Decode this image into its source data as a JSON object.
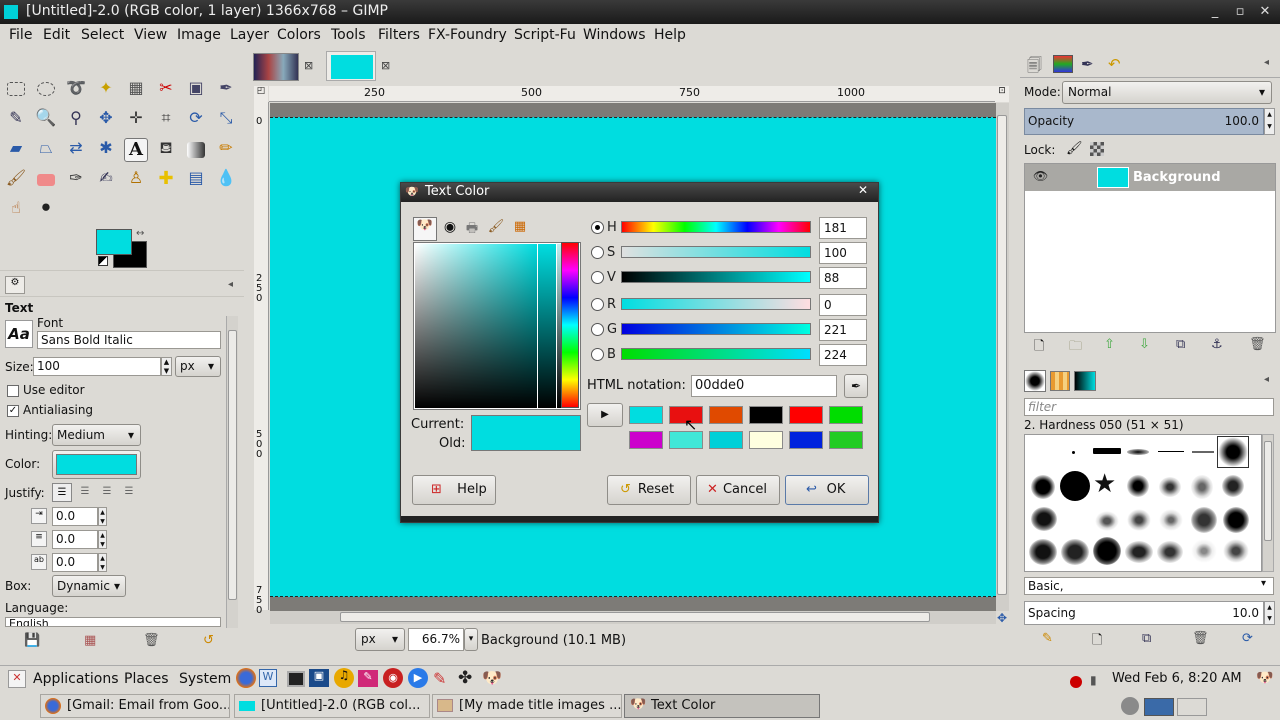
{
  "window": {
    "title": "[Untitled]-2.0 (RGB color, 1 layer) 1366x768 – GIMP"
  },
  "menu": [
    "File",
    "Edit",
    "Select",
    "View",
    "Image",
    "Layer",
    "Colors",
    "Tools",
    "Filters",
    "FX-Foundry",
    "Script-Fu",
    "Windows",
    "Help"
  ],
  "tool_options": {
    "title": "Text",
    "font_label": "Font",
    "font_value": "Sans Bold Italic",
    "size_label": "Size:",
    "size_value": "100",
    "size_unit": "px",
    "use_editor": "Use editor",
    "antialiasing": "Antialiasing",
    "hinting_label": "Hinting:",
    "hinting_value": "Medium",
    "color_label": "Color:",
    "justify_label": "Justify:",
    "indent": "0.0",
    "line_spacing": "0.0",
    "letter_spacing": "0.0",
    "box_label": "Box:",
    "box_value": "Dynamic",
    "language_label": "Language:",
    "language_value": "English"
  },
  "ruler": {
    "marks": [
      "250",
      "500",
      "750",
      "1000"
    ],
    "vmarks": [
      "0",
      "250",
      "500",
      "750"
    ]
  },
  "statusbar": {
    "unit": "px",
    "zoom": "66.7%",
    "layer_info": "Background (10.1 MB)"
  },
  "dialog": {
    "title": "Text Color",
    "channels": [
      {
        "key": "H",
        "value": "181"
      },
      {
        "key": "S",
        "value": "100"
      },
      {
        "key": "V",
        "value": "88"
      },
      {
        "key": "R",
        "value": "0"
      },
      {
        "key": "G",
        "value": "221"
      },
      {
        "key": "B",
        "value": "224"
      }
    ],
    "html_notation_label": "HTML notation:",
    "html_notation_value": "00dde0",
    "current_label": "Current:",
    "old_label": "Old:",
    "help": "Help",
    "reset": "Reset",
    "cancel": "Cancel",
    "ok": "OK",
    "history": [
      "#00dde0",
      "#e81010",
      "#e04a00",
      "#000000",
      "#ff0000",
      "#00dd00",
      "#cc00cc",
      "#40e8d8",
      "#00d0d8",
      "#ffffe0",
      "#0022dd",
      "#22cc22"
    ]
  },
  "layers": {
    "mode_label": "Mode:",
    "mode_value": "Normal",
    "opacity_label": "Opacity",
    "opacity_value": "100.0",
    "lock_label": "Lock:",
    "layer_name": "Background"
  },
  "brushes": {
    "filter_placeholder": "filter",
    "current": "2. Hardness 050 (51 × 51)",
    "tag": "Basic,",
    "spacing_label": "Spacing",
    "spacing_value": "10.0"
  },
  "taskbar": {
    "applications": "Applications",
    "places": "Places",
    "system": "System",
    "clock": "Wed Feb  6,  8:20 AM",
    "tasks": [
      "[Gmail: Email from Goo...",
      "[Untitled]-2.0 (RGB col...",
      "[My made title images ...",
      "Text Color"
    ]
  },
  "colors": {
    "fg": "#00dde0",
    "canvas": "#00dde0"
  }
}
